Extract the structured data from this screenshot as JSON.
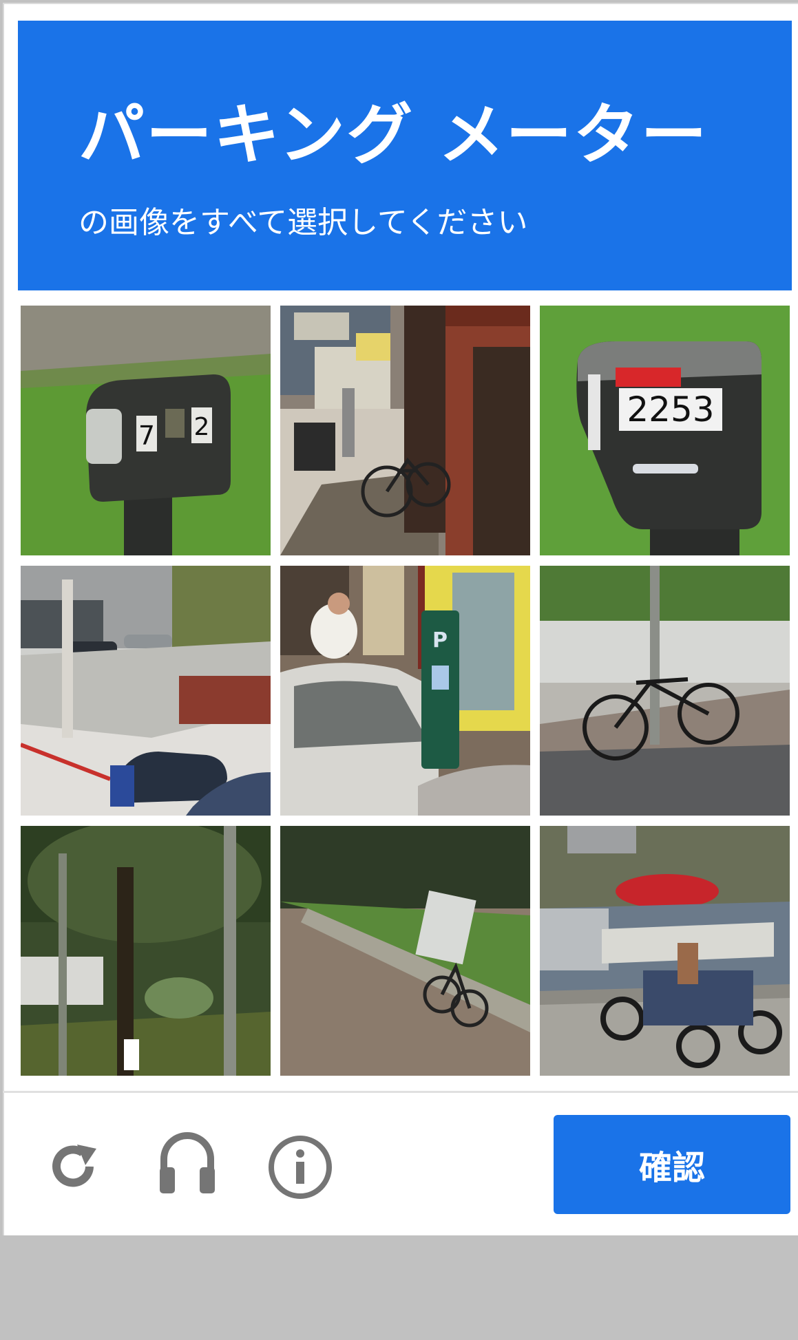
{
  "header": {
    "title": "パーキング メーター",
    "subtitle": "の画像をすべて選択してください"
  },
  "tiles": [
    {
      "content": "parking-meter-closeup",
      "meter_labels": [
        "7",
        "2"
      ]
    },
    {
      "content": "street-sidewalk-bicycle"
    },
    {
      "content": "parking-meter-closeup",
      "meter_labels": [
        "2253"
      ]
    },
    {
      "content": "street-intersection-scooter"
    },
    {
      "content": "street-car-parking-meter",
      "meter_labels": [
        "P"
      ]
    },
    {
      "content": "bicycle-by-pole"
    },
    {
      "content": "park-trees"
    },
    {
      "content": "path-bicycle"
    },
    {
      "content": "street-motorcycles-umbrella"
    }
  ],
  "footer": {
    "reload_icon": "reload-icon",
    "audio_icon": "headphones-icon",
    "info_icon": "info-icon",
    "verify_label": "確認"
  },
  "colors": {
    "accent": "#1a73e8",
    "icon_gray": "#757575",
    "backdrop": "#c1c1c1"
  }
}
